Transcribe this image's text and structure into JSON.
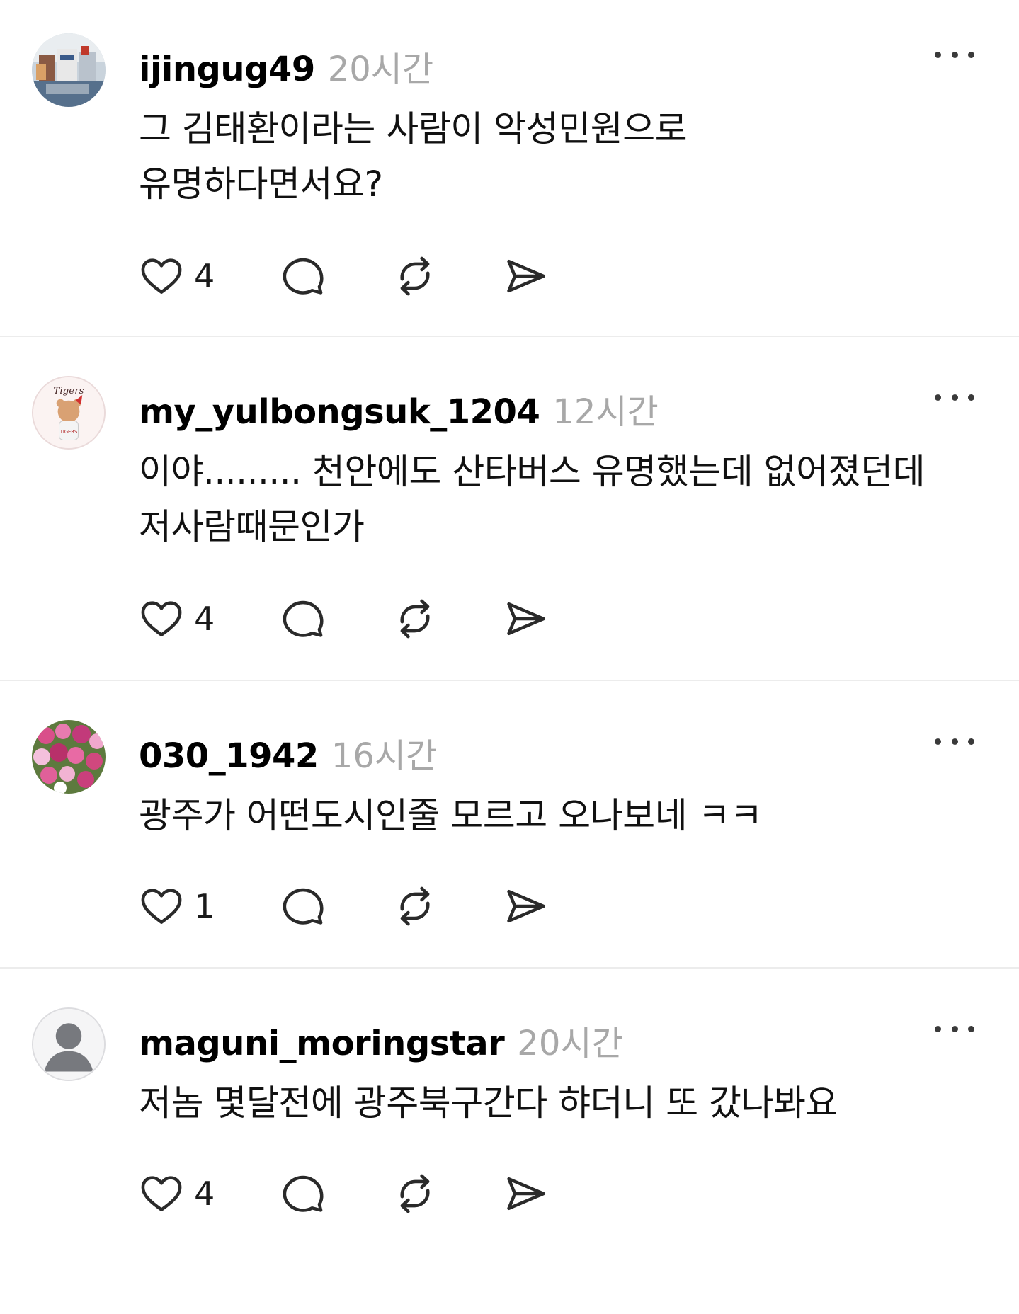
{
  "posts": [
    {
      "username": "ijingug49",
      "time": "20시간",
      "text_lines": [
        "그 김태환이라는 사람이 악성민원으로",
        "유명하다면서요?"
      ],
      "likes": "4",
      "avatar": "toy-figures-photo"
    },
    {
      "username": "my_yulbongsuk_1204",
      "time": "12시간",
      "text_lines": [
        "이야......... 천안에도 산타버스 유명했는데 없어졌던데",
        "저사람때문인가"
      ],
      "likes": "4",
      "avatar": "kia-tigers-bear-photo"
    },
    {
      "username": "030_1942",
      "time": "16시간",
      "text_lines": [
        "광주가 어떤도시인줄 모르고 오나보네 ㅋㅋ"
      ],
      "likes": "1",
      "avatar": "pink-flowers-photo"
    },
    {
      "username": "maguni_moringstar",
      "time": "20시간",
      "text_lines": [
        "저놈 몇달전에 광주북구간다 햐더니 또 갔나봐요"
      ],
      "likes": "4",
      "avatar": "default-user-icon"
    }
  ],
  "icons": {
    "like": "heart-icon",
    "comment": "comment-bubble-icon",
    "repost": "repost-icon",
    "share": "share-send-icon",
    "more": "more-options-icon"
  },
  "colors": {
    "text": "#111111",
    "time": "#a8a8a8",
    "icon": "#2a2a2a",
    "divider": "#ececec"
  }
}
